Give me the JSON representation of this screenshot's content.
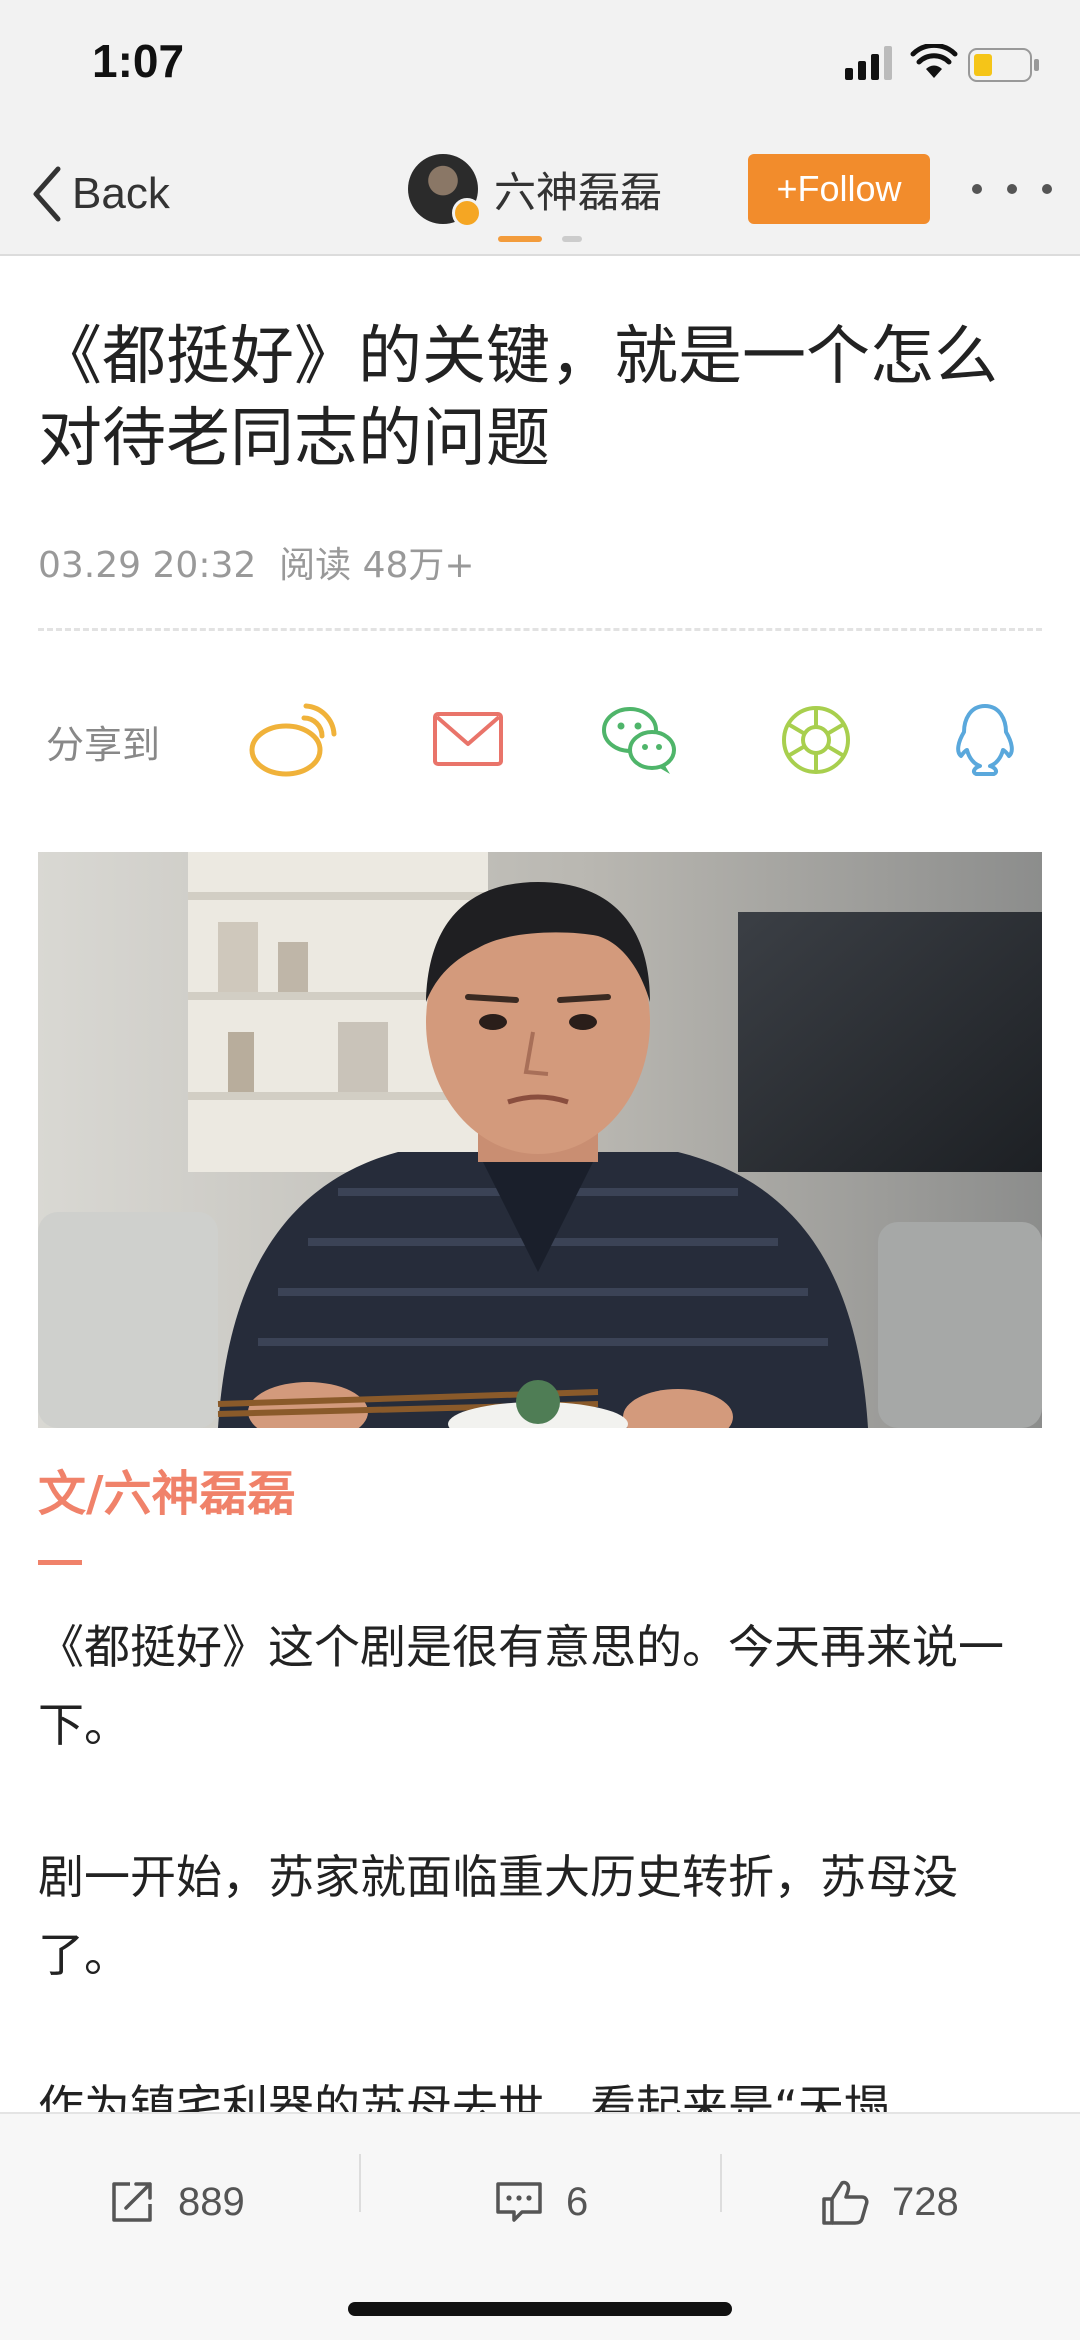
{
  "status_bar": {
    "time": "1:07"
  },
  "nav": {
    "back_label": "Back",
    "author_name": "六神磊磊",
    "follow_label": "+Follow"
  },
  "article": {
    "title": "《都挺好》的关键，就是一个怎么对待老同志的问题",
    "date": "03.29 20:32",
    "reads": "阅读 48万+",
    "share_label": "分享到",
    "byline": "文/六神磊磊",
    "paragraphs": [
      "《都挺好》这个剧是很有意思的。今天再来说一下。",
      "剧一开始，苏家就面临重大历史转折，苏母没了。",
      "作为镇宅利器的苏母去世，看起来是“天塌"
    ]
  },
  "share_targets": [
    "weibo-icon",
    "mail-icon",
    "wechat-icon",
    "moments-icon",
    "qq-icon"
  ],
  "actions": {
    "repost_count": "889",
    "comment_count": "6",
    "like_count": "728"
  },
  "colors": {
    "accent_orange": "#f28c2c",
    "byline_red": "#f0826a",
    "weibo_yellow": "#f0b23a",
    "mail_red": "#e9746a",
    "wechat_green": "#4fb56a",
    "moments_green": "#a8cf4e",
    "qq_blue": "#5aa8dc"
  }
}
